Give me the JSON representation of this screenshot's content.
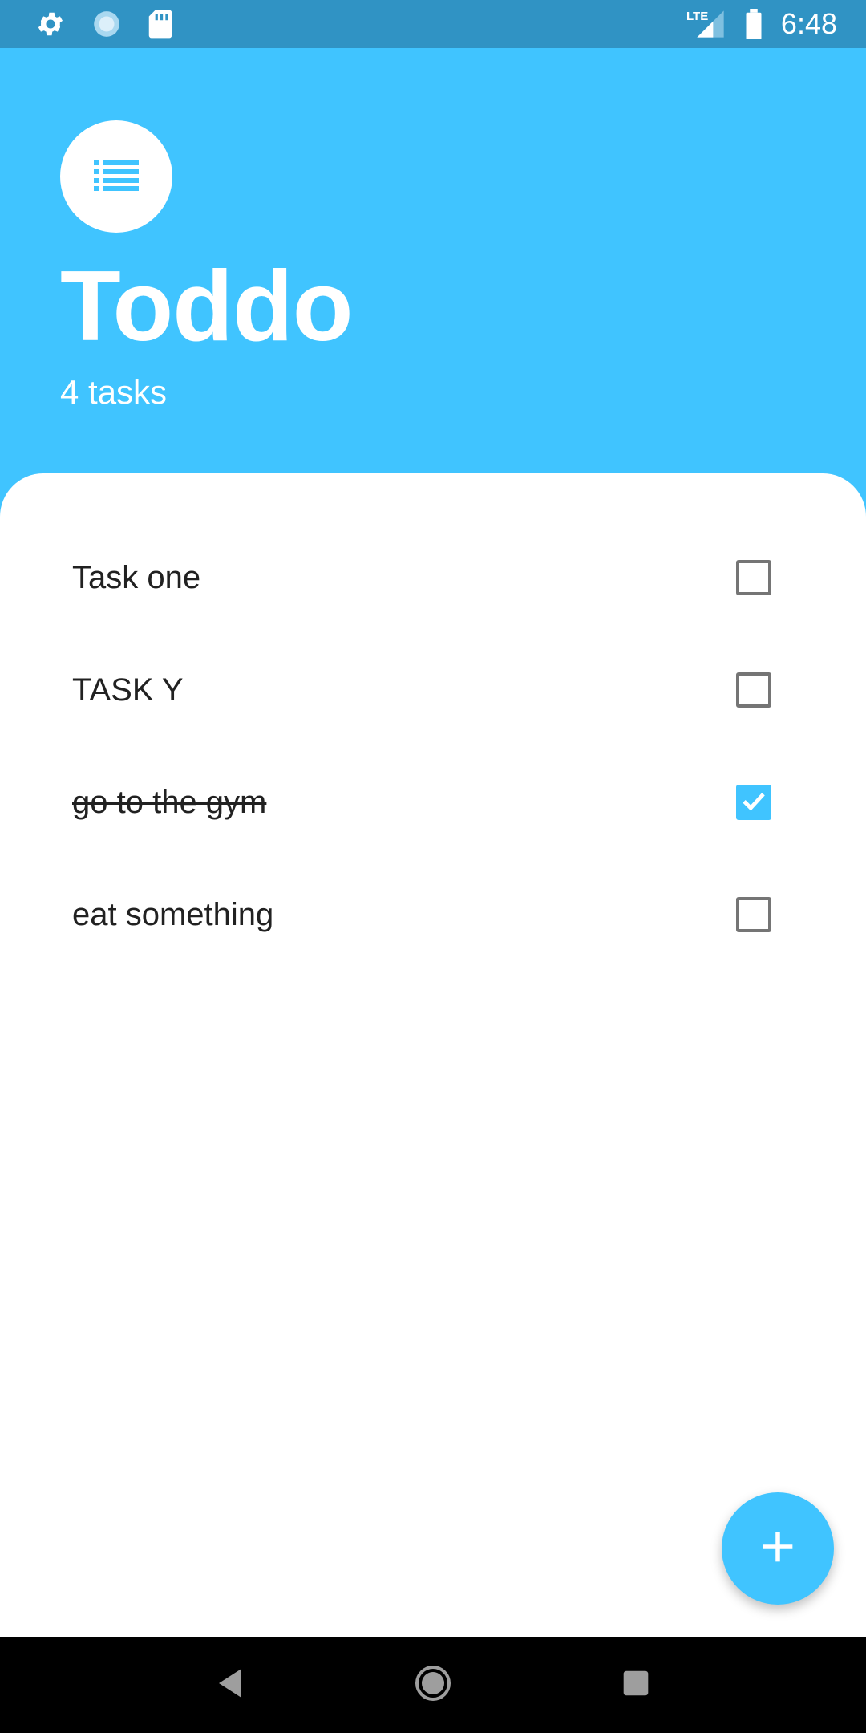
{
  "status_bar": {
    "time": "6:48",
    "network": "LTE",
    "icons": [
      "gear-icon",
      "sync-icon",
      "sd-card-icon",
      "signal-icon",
      "battery-icon"
    ]
  },
  "header": {
    "title": "Toddo",
    "task_count": "4 tasks",
    "icon": "list-icon"
  },
  "tasks": [
    {
      "label": "Task one",
      "done": false
    },
    {
      "label": "TASK Y",
      "done": false
    },
    {
      "label": "go to the gym",
      "done": true
    },
    {
      "label": "eat something",
      "done": false
    }
  ],
  "fab": {
    "icon": "plus-icon"
  },
  "nav": {
    "icons": [
      "back-icon",
      "home-icon",
      "recents-icon"
    ]
  },
  "colors": {
    "accent": "#40C4FF",
    "status_bar": "#3093C4",
    "text": "#212121",
    "checkbox_border": "#757575"
  }
}
